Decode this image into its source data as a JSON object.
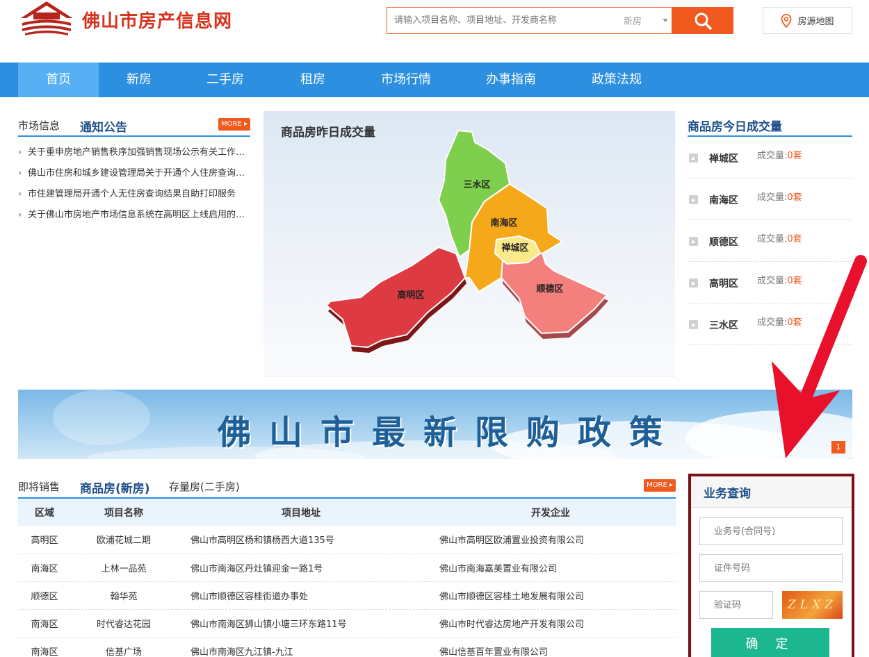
{
  "header": {
    "site_name": "佛山市房产信息网",
    "search_placeholder": "请输入项目名称、项目地址、开发商名称",
    "search_type": "新房",
    "map_button": "房源地图"
  },
  "colors": {
    "nav_blue": "#2c8fe0",
    "nav_active": "#56b0f3",
    "accent_orange": "#f05a1f",
    "heading_blue": "#1e4f8a",
    "submit_green": "#1cb68f",
    "highlight_frame": "#7a0f16"
  },
  "nav": {
    "items": [
      "首页",
      "新房",
      "二手房",
      "租房",
      "市场行情",
      "办事指南",
      "政策法规"
    ],
    "active": "首页"
  },
  "notices": {
    "tab_muted": "市场信息",
    "tab_active": "通知公告",
    "more": "MORE",
    "items": [
      "关于重申房地产销售秩序加强销售现场公示有关工作的通知",
      "佛山市住房和城乡建设管理局关于开通个人住房查询结果自助打印服务的通告",
      "市住建管理局开通个人无住房查询结果自助打印服务",
      "关于佛山市房地产市场信息系统在高明区上线启用的通告"
    ]
  },
  "map": {
    "title": "商品房昨日成交量",
    "districts": [
      "三水区",
      "南海区",
      "禅城区",
      "高明区",
      "顺德区"
    ]
  },
  "today": {
    "title": "商品房今日成交量",
    "label": "成交量:",
    "rows": [
      {
        "district": "禅城区",
        "value": "0套"
      },
      {
        "district": "南海区",
        "value": "0套"
      },
      {
        "district": "顺德区",
        "value": "0套"
      },
      {
        "district": "高明区",
        "value": "0套"
      },
      {
        "district": "三水区",
        "value": "0套"
      }
    ]
  },
  "banner": {
    "text": "佛山市最新限购政策",
    "page": "1"
  },
  "sales": {
    "tab_muted": "即将销售",
    "tab_active": "商品房(新房)",
    "tab_third": "存量房(二手房)",
    "more": "MORE",
    "columns": [
      "区域",
      "项目名称",
      "项目地址",
      "开发企业"
    ],
    "rows": [
      [
        "高明区",
        "欧浦花城二期",
        "佛山市高明区杨和镇杨西大道135号",
        "佛山市高明区欧浦置业投资有限公司"
      ],
      [
        "南海区",
        "上林一品苑",
        "佛山市南海区丹灶镇迎金一路1号",
        "佛山市南海嘉美置业有限公司"
      ],
      [
        "顺德区",
        "翰华苑",
        "佛山市顺德区容桂街道办事处",
        "佛山市顺德区容桂土地发展有限公司"
      ],
      [
        "南海区",
        "时代睿达花园",
        "佛山市南海区狮山镇小塘三环东路11号",
        "佛山市时代睿达房地产开发有限公司"
      ],
      [
        "南海区",
        "信基广场",
        "佛山市南海区九江镇-九江",
        "佛山信基百年置业有限公司"
      ]
    ]
  },
  "query": {
    "title": "业务查询",
    "contract_placeholder": "业务号(合同号)",
    "id_placeholder": "证件号码",
    "captcha_placeholder": "验证码",
    "captcha_text": "ZLXZ",
    "submit": "确 定"
  }
}
